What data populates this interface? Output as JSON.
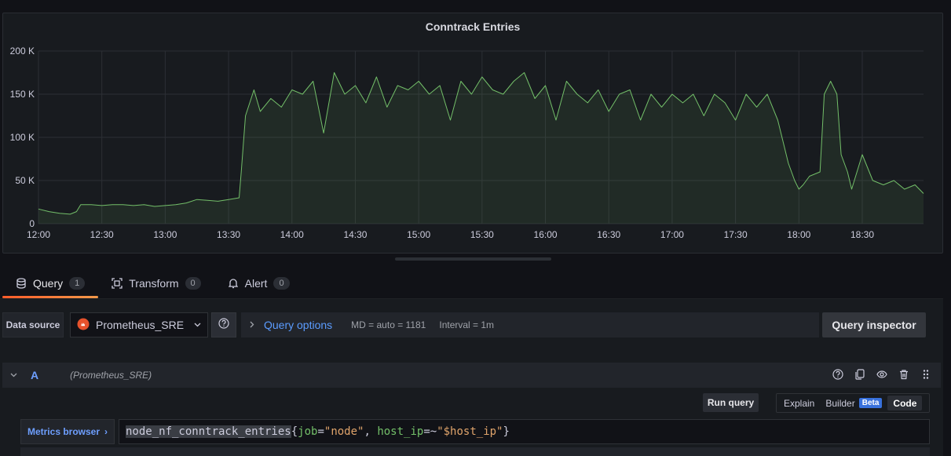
{
  "panel": {
    "title": "Conntrack Entries"
  },
  "chart_data": {
    "type": "line",
    "title": "Conntrack Entries",
    "xlabel": "",
    "ylabel": "",
    "x_ticks": [
      "12:00",
      "12:30",
      "13:00",
      "13:30",
      "14:00",
      "14:30",
      "15:00",
      "15:30",
      "16:00",
      "16:30",
      "17:00",
      "17:30",
      "18:00",
      "18:30"
    ],
    "y_ticks": [
      "0",
      "50 K",
      "100 K",
      "150 K",
      "200 K"
    ],
    "ylim": [
      0,
      200000
    ],
    "xlim_minutes": [
      0,
      419
    ],
    "grid": true,
    "fill": true,
    "color": "#73bf69",
    "series": [
      {
        "x_minutes": [
          0,
          5,
          10,
          15,
          18,
          20,
          25,
          30,
          35,
          40,
          45,
          50,
          55,
          60,
          65,
          70,
          75,
          80,
          85,
          90,
          95,
          96,
          98,
          100,
          102,
          105,
          110,
          115,
          120,
          125,
          130,
          135,
          140,
          145,
          150,
          155,
          160,
          165,
          170,
          175,
          180,
          185,
          190,
          195,
          200,
          205,
          210,
          215,
          220,
          225,
          230,
          235,
          240,
          245,
          250,
          255,
          260,
          265,
          270,
          275,
          280,
          285,
          290,
          295,
          300,
          305,
          310,
          315,
          320,
          325,
          330,
          335,
          340,
          345,
          350,
          355,
          358,
          360,
          362,
          365,
          370,
          372,
          375,
          378,
          380,
          383,
          385,
          390,
          395,
          400,
          405,
          410,
          415,
          419
        ],
        "values": [
          17000,
          14000,
          12000,
          11000,
          14000,
          22000,
          22000,
          21000,
          22000,
          22000,
          21000,
          22000,
          20000,
          21000,
          22000,
          24000,
          28000,
          27000,
          26000,
          28000,
          30000,
          60000,
          125000,
          140000,
          155000,
          130000,
          145000,
          135000,
          155000,
          150000,
          165000,
          105000,
          175000,
          150000,
          160000,
          140000,
          170000,
          135000,
          160000,
          155000,
          165000,
          150000,
          160000,
          120000,
          165000,
          150000,
          170000,
          155000,
          150000,
          165000,
          175000,
          145000,
          160000,
          120000,
          165000,
          150000,
          140000,
          155000,
          130000,
          150000,
          155000,
          120000,
          150000,
          135000,
          150000,
          140000,
          150000,
          125000,
          150000,
          140000,
          120000,
          150000,
          135000,
          150000,
          120000,
          70000,
          50000,
          40000,
          45000,
          55000,
          60000,
          150000,
          165000,
          150000,
          80000,
          60000,
          40000,
          80000,
          50000,
          45000,
          50000,
          40000,
          45000,
          35000
        ]
      }
    ]
  },
  "tabs": [
    {
      "label": "Query",
      "count": "1",
      "icon": "database-icon",
      "active": true
    },
    {
      "label": "Transform",
      "count": "0",
      "icon": "transform-icon",
      "active": false
    },
    {
      "label": "Alert",
      "count": "0",
      "icon": "bell-icon",
      "active": false
    }
  ],
  "datasource": {
    "label": "Data source",
    "selected": "Prometheus_SRE",
    "help_icon": "help-icon"
  },
  "query_options": {
    "title": "Query options",
    "md": "MD = auto = 1181",
    "interval": "Interval = 1m"
  },
  "query_inspector": {
    "label": "Query inspector"
  },
  "query_row": {
    "letter": "A",
    "datasource": "(Prometheus_SRE)",
    "actions": [
      "help-icon",
      "duplicate-icon",
      "eye-icon",
      "trash-icon",
      "drag-handle-icon"
    ]
  },
  "editor_toolbar": {
    "run_query": "Run query",
    "modes": [
      {
        "label": "Explain",
        "selected": false
      },
      {
        "label": "Builder",
        "badge": "Beta",
        "selected": false
      },
      {
        "label": "Code",
        "selected": true
      }
    ]
  },
  "metrics_browser": {
    "label": "Metrics browser",
    "chevron": "›"
  },
  "query_code": {
    "metric": "node_nf_conntrack_entries",
    "open_brace": "{",
    "label1": "job",
    "op1": "=",
    "value1": "\"node\"",
    "sep": ", ",
    "label2": "host_ip",
    "op2": "=~",
    "value2": "\"$host_ip\"",
    "close_brace": "}"
  }
}
